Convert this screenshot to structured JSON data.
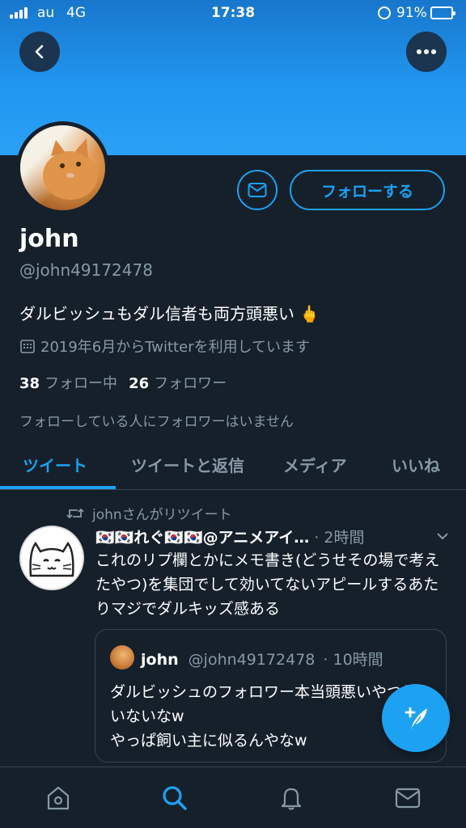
{
  "status_bar": {
    "carrier": "au",
    "network": "4G",
    "time": "17:38",
    "battery_percent": "91%"
  },
  "header": {
    "back_icon": "chevron-left-icon",
    "more_icon": "more-horizontal-icon"
  },
  "profile": {
    "display_name": "john",
    "handle": "@john49172478",
    "bio": "ダルビッシュもダル信者も両方頭悪い 🖕",
    "joined": "2019年6月からTwitterを利用しています",
    "following_count": "38",
    "following_label": "フォロー中",
    "followers_count": "26",
    "followers_label": "フォロワー",
    "no_common_followers": "フォローしている人にフォロワーはいません",
    "follow_label": "フォローする"
  },
  "tabs": [
    {
      "label": "ツイート",
      "active": true
    },
    {
      "label": "ツイートと返信",
      "active": false
    },
    {
      "label": "メディア",
      "active": false
    },
    {
      "label": "いいね",
      "active": false
    }
  ],
  "tweet": {
    "retweet_context": "johnさんがリツイート",
    "author": "🇰🇷🇰🇷れぐ🇰🇷🇰🇷@アニメアイ…",
    "time": "· 2時間",
    "text": "これのリプ欄とかにメモ書き(どうせその場で考えたやつ)を集団でして効いてないアピールするあたりマジでダルキッズ感ある",
    "quote": {
      "name": "john",
      "handle": "@john49172478",
      "time": "· 10時間",
      "text": "ダルビッシュのフォロワー本当頭悪いやつしかいないなw\nやっぱ飼い主に似るんやなw"
    }
  },
  "colors": {
    "background": "#15202b",
    "accent": "#1da1f2",
    "muted_text": "#8899a6",
    "border": "#38444d"
  },
  "bottom_nav": [
    "home-icon",
    "search-icon",
    "notifications-icon",
    "messages-icon"
  ]
}
